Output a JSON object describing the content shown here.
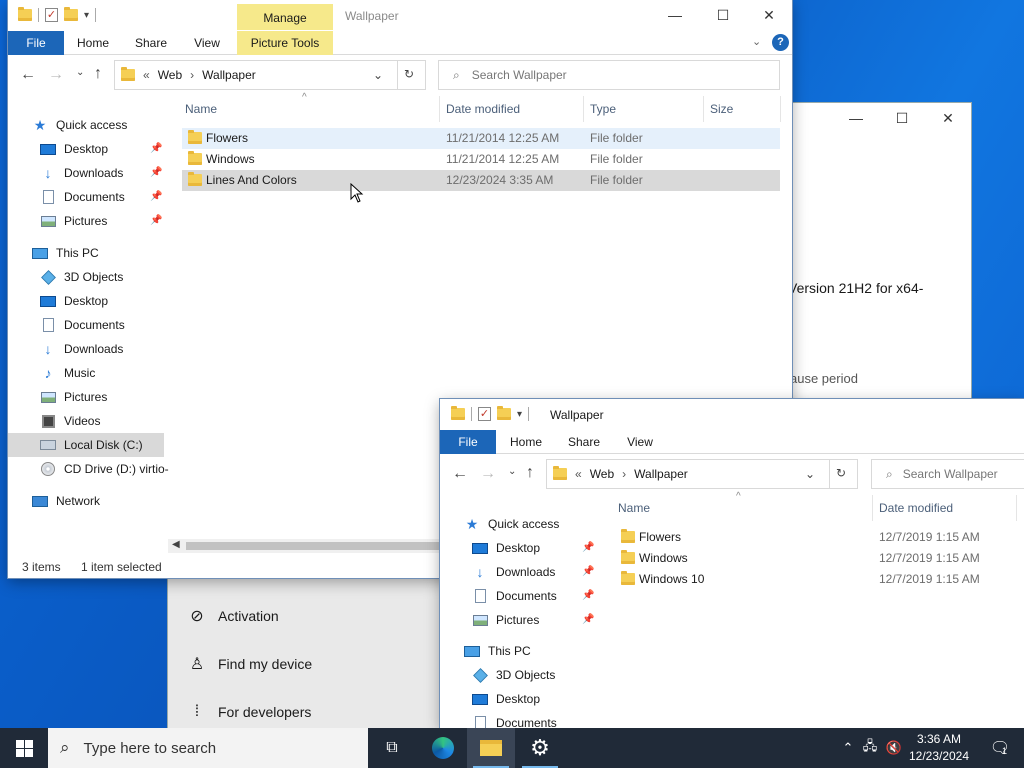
{
  "settings_window": {
    "caption": {
      "minimize": "—",
      "maximize": "☐",
      "close": "✕"
    },
    "text_version": "Version 21H2 for x64-",
    "text_pause": "ause period",
    "nav": [
      {
        "label": "Activation",
        "icon": "check-circle-icon"
      },
      {
        "label": "Find my device",
        "icon": "person-icon"
      },
      {
        "label": "For developers",
        "icon": "developer-icon"
      }
    ]
  },
  "explorer_main": {
    "title": "Wallpaper",
    "manage_tab": "Manage",
    "ribbon_tabs": [
      "File",
      "Home",
      "Share",
      "View",
      "Picture Tools"
    ],
    "caption": {
      "minimize": "—",
      "maximize": "☐",
      "close": "✕"
    },
    "address": {
      "overflow": "«",
      "crumbs": [
        "Web",
        "Wallpaper"
      ]
    },
    "search_placeholder": "Search Wallpaper",
    "nav": {
      "quick_access": "Quick access",
      "quick_items": [
        "Desktop",
        "Downloads",
        "Documents",
        "Pictures"
      ],
      "this_pc": "This PC",
      "pc_items": [
        "3D Objects",
        "Desktop",
        "Documents",
        "Downloads",
        "Music",
        "Pictures",
        "Videos",
        "Local Disk (C:)",
        "CD Drive (D:) virtio-"
      ],
      "network": "Network"
    },
    "columns": [
      "Name",
      "Date modified",
      "Type",
      "Size"
    ],
    "rows": [
      {
        "name": "Flowers",
        "date": "11/21/2014 12:25 AM",
        "type": "File folder"
      },
      {
        "name": "Windows",
        "date": "11/21/2014 12:25 AM",
        "type": "File folder"
      },
      {
        "name": "Lines And Colors",
        "date": "12/23/2024 3:35 AM",
        "type": "File folder"
      }
    ],
    "status": {
      "items": "3 items",
      "selected": "1 item selected"
    }
  },
  "explorer_second": {
    "title": "Wallpaper",
    "ribbon_tabs": [
      "File",
      "Home",
      "Share",
      "View"
    ],
    "address": {
      "overflow": "«",
      "crumbs": [
        "Web",
        "Wallpaper"
      ]
    },
    "search_placeholder": "Search Wallpaper",
    "nav": {
      "quick_access": "Quick access",
      "quick_items": [
        "Desktop",
        "Downloads",
        "Documents",
        "Pictures"
      ],
      "this_pc": "This PC",
      "pc_items": [
        "3D Objects",
        "Desktop",
        "Documents"
      ]
    },
    "columns": [
      "Name",
      "Date modified"
    ],
    "rows": [
      {
        "name": "Flowers",
        "date": "12/7/2019 1:15 AM"
      },
      {
        "name": "Windows",
        "date": "12/7/2019 1:15 AM"
      },
      {
        "name": "Windows 10",
        "date": "12/7/2019 1:15 AM"
      }
    ]
  },
  "taskbar": {
    "search_placeholder": "Type here to search",
    "clock_time": "3:36 AM",
    "clock_date": "12/23/2024",
    "notification_count": "1"
  },
  "colors": {
    "accent": "#1c66b8",
    "taskbar": "#202a38",
    "manage_tab": "#f6e98b"
  }
}
